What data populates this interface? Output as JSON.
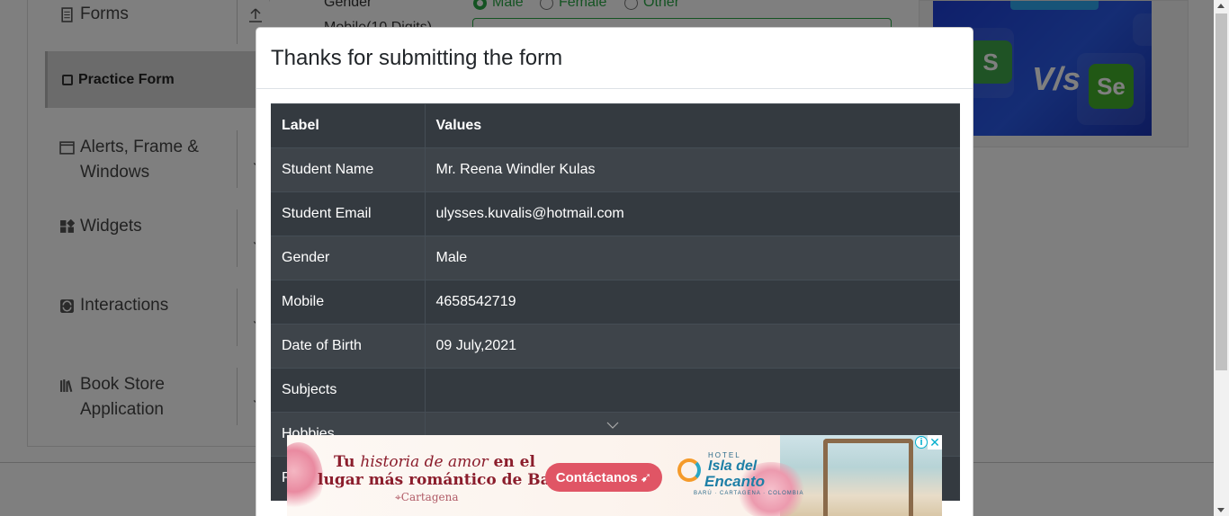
{
  "sidebar": {
    "groups": [
      {
        "label": "Forms",
        "icon": "document-icon"
      },
      {
        "label": "Alerts, Frame & Windows",
        "icon": "window-icon"
      },
      {
        "label": "Widgets",
        "icon": "widgets-icon"
      },
      {
        "label": "Interactions",
        "icon": "interactions-icon"
      },
      {
        "label": "Book Store Application",
        "icon": "books-icon"
      }
    ],
    "active_item": "Practice Form"
  },
  "form": {
    "gender_label": "Gender",
    "gender_options": [
      "Male",
      "Female",
      "Other"
    ],
    "mobile_label": "Mobile(10 Digits)"
  },
  "modal": {
    "title": "Thanks for submitting the form",
    "columns": [
      "Label",
      "Values"
    ],
    "rows": [
      {
        "label": "Student Name",
        "value": "Mr. Reena Windler Kulas"
      },
      {
        "label": "Student Email",
        "value": "ulysses.kuvalis@hotmail.com"
      },
      {
        "label": "Gender",
        "value": "Male"
      },
      {
        "label": "Mobile",
        "value": "4658542719"
      },
      {
        "label": "Date of Birth",
        "value": "09 July,2021"
      },
      {
        "label": "Subjects",
        "value": ""
      },
      {
        "label": "Hobbies",
        "value": ""
      },
      {
        "label": "Picture",
        "value": ""
      }
    ]
  },
  "ad_bottom": {
    "line1_italic": "historia de amor",
    "line1_pre": "Tu",
    "line1_post": "en el",
    "line2": "lugar más romántico de Barú",
    "location": "Cartagena",
    "cta": "Contáctanos",
    "hotel_top": "HOTEL",
    "hotel_name1": "Isla del",
    "hotel_name2": "Encanto",
    "hotel_sub": "BARÚ · CARTAGENA · COLOMBIA",
    "info_glyph": "i",
    "close_glyph": "✕"
  },
  "ad_right": {
    "badge1": "S",
    "vs": "V/s",
    "badge2": "Se"
  },
  "colors": {
    "overlay": "#000000",
    "table_dark": "#343a40",
    "table_stripe": "#3e444a",
    "accent_green": "#28a745",
    "ad_blue": "#2a5ae8"
  }
}
